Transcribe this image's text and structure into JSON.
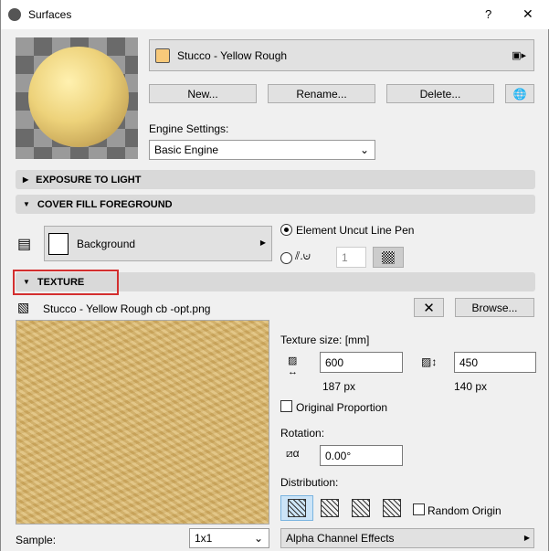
{
  "window": {
    "title": "Surfaces",
    "help": "?",
    "close": "✕"
  },
  "material": {
    "name": "Stucco - Yellow Rough",
    "swatch_color": "#f7c97a"
  },
  "buttons": {
    "new": "New...",
    "rename": "Rename...",
    "delete": "Delete..."
  },
  "engine": {
    "label": "Engine Settings:",
    "value": "Basic Engine"
  },
  "sections": {
    "exposure": "EXPOSURE TO LIGHT",
    "cover_fill": "COVER FILL FOREGROUND",
    "texture": "TEXTURE"
  },
  "cover_fill": {
    "fill_name": "Background",
    "radio1_label": "Element Uncut Line Pen",
    "pen_value": "1"
  },
  "texture": {
    "file": "Stucco - Yellow Rough cb -opt.png",
    "browse": "Browse...",
    "remove": "✕",
    "size_label": "Texture size: [mm]",
    "width": "600",
    "height": "450",
    "width_px": "187 px",
    "height_px": "140 px",
    "original_proportion": "Original Proportion",
    "rotation_label": "Rotation:",
    "rotation": "0.00°",
    "distribution_label": "Distribution:",
    "random_origin": "Random Origin",
    "sample_label": "Sample:",
    "sample_value": "1x1",
    "alpha": "Alpha Channel Effects"
  }
}
